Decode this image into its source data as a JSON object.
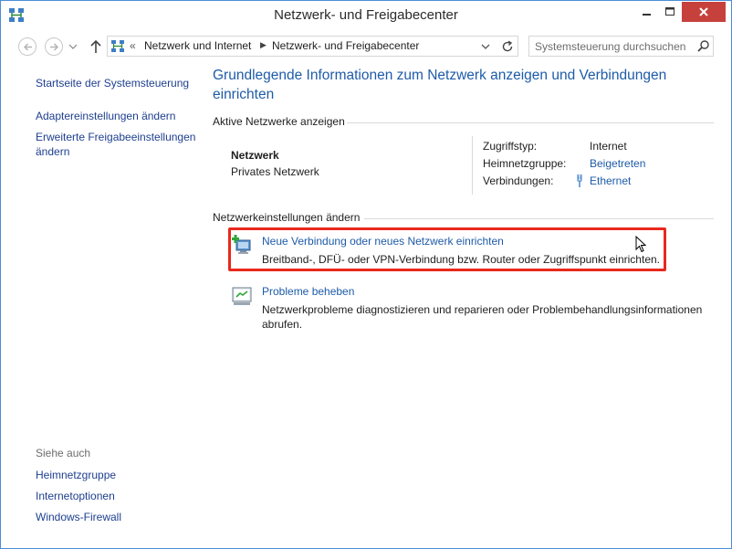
{
  "window": {
    "title": "Netzwerk- und Freigabecenter"
  },
  "address_bar": {
    "overflow": "«",
    "crumbs": [
      "Netzwerk und Internet",
      "Netzwerk- und Freigabecenter"
    ]
  },
  "search": {
    "placeholder": "Systemsteuerung durchsuchen"
  },
  "sidebar": {
    "links": [
      "Startseite der Systemsteuerung",
      "Adaptereinstellungen ändern",
      "Erweiterte Freigabeeinstellungen ändern"
    ],
    "see_also_label": "Siehe auch",
    "see_also": [
      "Heimnetzgruppe",
      "Internetoptionen",
      "Windows-Firewall"
    ]
  },
  "main": {
    "title": "Grundlegende Informationen zum Netzwerk anzeigen und Verbindungen einrichten",
    "active_networks_heading": "Aktive Netzwerke anzeigen",
    "network": {
      "name": "Netzwerk",
      "category": "Privates Netzwerk",
      "access_type_label": "Zugriffstyp:",
      "access_type_value": "Internet",
      "homegroup_label": "Heimnetzgruppe:",
      "homegroup_value": "Beigetreten",
      "connections_label": "Verbindungen:",
      "connections_value": "Ethernet"
    },
    "change_settings_heading": "Netzwerkeinstellungen ändern",
    "tasks": [
      {
        "title": "Neue Verbindung oder neues Netzwerk einrichten",
        "description": "Breitband-, DFÜ- oder VPN-Verbindung bzw. Router oder Zugriffspunkt einrichten."
      },
      {
        "title": "Probleme beheben",
        "description": "Netzwerkprobleme diagnostizieren und reparieren oder Problembehandlungsinformationen abrufen."
      }
    ]
  },
  "colors": {
    "link": "#1e5ba8",
    "highlight": "#e8291c",
    "close_button": "#c7413c"
  }
}
